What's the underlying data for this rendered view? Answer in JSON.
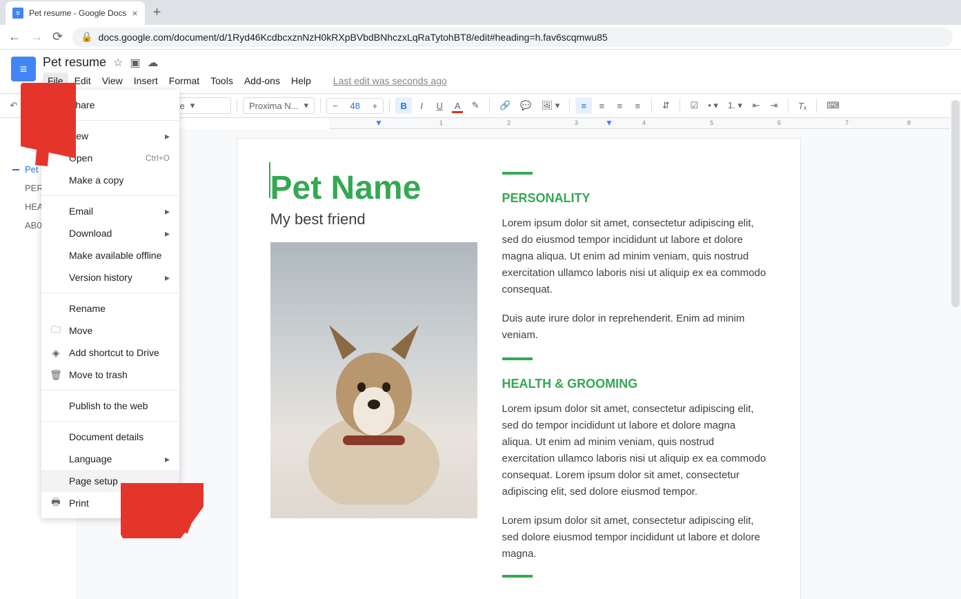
{
  "browser": {
    "tab_title": "Pet resume - Google Docs",
    "url_display": "docs.google.com/document/d/1Ryd46KcdbcxznNzH0kRXpBVbdBNhczxLqRaTytohBT8/edit#heading=h.fav6scqmwu85"
  },
  "docs": {
    "title": "Pet resume",
    "menus": [
      "File",
      "Edit",
      "View",
      "Insert",
      "Format",
      "Tools",
      "Add-ons",
      "Help"
    ],
    "last_edit": "Last edit was seconds ago"
  },
  "toolbar": {
    "style_name": "tle",
    "font_name": "Proxima N...",
    "font_size": "48"
  },
  "outline": {
    "items": [
      "Pet",
      "PER",
      "HEA",
      "AB0"
    ]
  },
  "file_menu": {
    "share": "Share",
    "new": "New",
    "open": "Open",
    "open_shortcut": "Ctrl+O",
    "make_copy": "Make a copy",
    "email": "Email",
    "download": "Download",
    "offline": "Make available offline",
    "version": "Version history",
    "rename": "Rename",
    "move": "Move",
    "shortcut_drive": "Add shortcut to Drive",
    "trash": "Move to trash",
    "publish": "Publish to the web",
    "details": "Document details",
    "language": "Language",
    "page_setup": "Page setup",
    "print": "Print"
  },
  "document": {
    "title": "Pet Name",
    "subtitle": "My best friend",
    "section1_head": "PERSONALITY",
    "section1_p1": "Lorem ipsum dolor sit amet, consectetur adipiscing elit, sed do eiusmod tempor incididunt ut labore et dolore magna aliqua. Ut enim ad minim veniam, quis nostrud exercitation ullamco laboris nisi ut aliquip ex ea commodo consequat.",
    "section1_p2": "Duis aute irure dolor in reprehenderit. Enim ad minim veniam.",
    "section2_head": "HEALTH & GROOMING",
    "section2_p1": "Lorem ipsum dolor sit amet, consectetur adipiscing elit, sed do tempor incididunt ut labore et dolore magna aliqua. Ut enim ad minim veniam, quis nostrud exercitation ullamco laboris nisi ut aliquip ex ea commodo consequat. Lorem ipsum dolor sit amet, consectetur adipiscing elit, sed dolore eiusmod tempor.",
    "section2_p2": "Lorem ipsum dolor sit amet, consectetur adipiscing elit, sed dolore eiusmod tempor incididunt ut labore et dolore magna."
  },
  "ruler": {
    "marks": [
      "1",
      "2",
      "3",
      "4",
      "5",
      "6",
      "7",
      "8"
    ]
  }
}
